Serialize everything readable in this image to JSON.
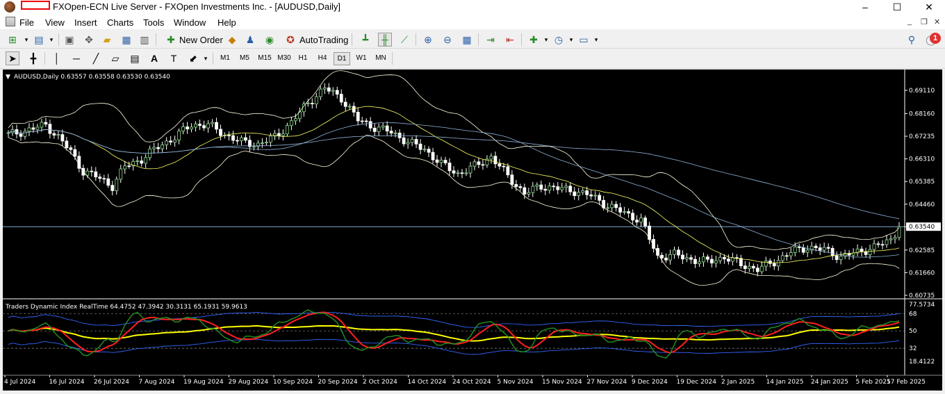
{
  "window": {
    "title": "FXOpen-ECN Live Server - FXOpen Investments Inc. - [AUDUSD,Daily]",
    "minimize": "–",
    "maximize": "☐",
    "close": "✕"
  },
  "menu": {
    "items": [
      "File",
      "View",
      "Insert",
      "Charts",
      "Tools",
      "Window",
      "Help"
    ],
    "mdi_minimize": "_",
    "mdi_restore": "❐",
    "mdi_close": "✕"
  },
  "toolbar": {
    "new_order_label": "New Order",
    "autotrading_label": "AutoTrading",
    "notification_count": "1"
  },
  "timeframes": {
    "items": [
      "M1",
      "M5",
      "M15",
      "M30",
      "H1",
      "H4",
      "D1",
      "W1",
      "MN"
    ],
    "active": "D1"
  },
  "chart": {
    "header": "AUDUSD,Daily  0.63557 0.63558 0.63530 0.63540",
    "price_ticks": [
      "0.69110",
      "0.68160",
      "0.67235",
      "0.66310",
      "0.65385",
      "0.64460",
      "0.63540",
      "0.62585",
      "0.61660",
      "0.60735"
    ],
    "current_price": "0.63540",
    "indicator_header": "Traders Dynamic Index RealTime 64.4752 47.3942 30.3131 65.1931 59.9613",
    "indicator_ticks": [
      "77.5734",
      "68",
      "50",
      "32",
      "18.4122"
    ],
    "date_labels": [
      "4 Jul 2024",
      "16 Jul 2024",
      "26 Jul 2024",
      "7 Aug 2024",
      "19 Aug 2024",
      "29 Aug 2024",
      "10 Sep 2024",
      "20 Sep 2024",
      "2 Oct 2024",
      "14 Oct 2024",
      "24 Oct 2024",
      "5 Nov 2024",
      "15 Nov 2024",
      "27 Nov 2024",
      "9 Dec 2024",
      "19 Dec 2024",
      "2 Jan 2025",
      "14 Jan 2025",
      "24 Jan 2025",
      "5 Feb 2025",
      "17 Feb 2025"
    ],
    "colors": {
      "background": "#000000",
      "candle_up": "#2e8b2e",
      "candle_down": "#ffffff",
      "bands": "#ffffe0",
      "ma_yellow": "#ffff66",
      "ma_blue": "#8fb3d9",
      "tdi_green": "#228b22",
      "tdi_red": "#ff2020",
      "tdi_yellow": "#ffff00",
      "tdi_blue": "#3366ff"
    }
  }
}
